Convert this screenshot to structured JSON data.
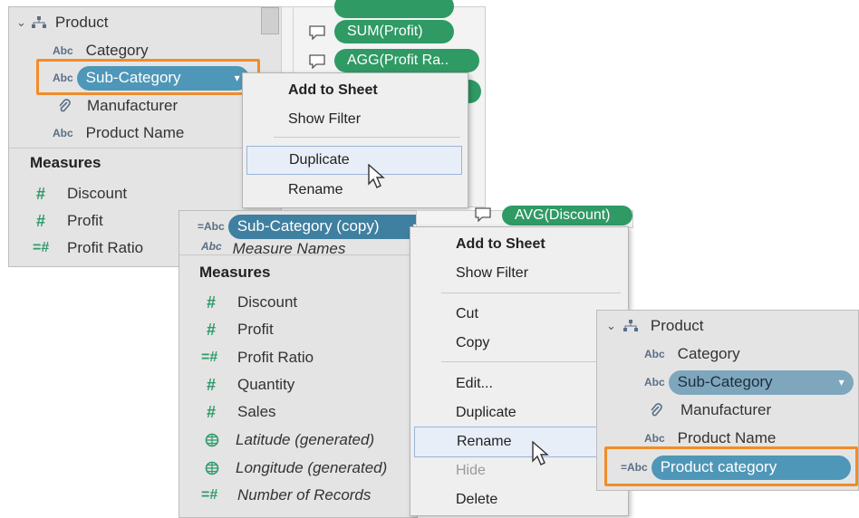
{
  "panel1": {
    "dimension_group": "Product",
    "dimensions": [
      {
        "type": "Abc",
        "label": "Category"
      },
      {
        "type": "Abc",
        "label": "Sub-Category",
        "selected": true
      },
      {
        "type": "clip",
        "label": "Manufacturer"
      },
      {
        "type": "Abc",
        "label": "Product Name"
      }
    ],
    "measures_heading": "Measures",
    "measures": [
      "Discount",
      "Profit",
      "Profit Ratio"
    ]
  },
  "marks": [
    "SUM(Profit)",
    "AGG(Profit Ra..",
    "AVG(Discount)"
  ],
  "menu1": {
    "items": [
      "Add to Sheet",
      "Show Filter",
      "Duplicate",
      "Rename"
    ],
    "highlighted": "Duplicate"
  },
  "panel2": {
    "copy_pill": "Sub-Category (copy)",
    "copy_prefix": "=Abc",
    "partial_item": "Measure Names",
    "measures_heading": "Measures",
    "measures": [
      {
        "type": "hash",
        "label": "Discount"
      },
      {
        "type": "hash",
        "label": "Profit"
      },
      {
        "type": "calc-hash",
        "label": "Profit Ratio"
      },
      {
        "type": "hash",
        "label": "Quantity"
      },
      {
        "type": "hash",
        "label": "Sales"
      },
      {
        "type": "globe",
        "label": "Latitude (generated)"
      },
      {
        "type": "globe",
        "label": "Longitude (generated)"
      },
      {
        "type": "calc-hash",
        "label": "Number of Records"
      }
    ]
  },
  "menu2": {
    "items": [
      "Add to Sheet",
      "Show Filter",
      "Cut",
      "Copy",
      "Edit...",
      "Duplicate",
      "Rename",
      "Hide",
      "Delete"
    ],
    "highlighted": "Rename",
    "disabled": "Hide"
  },
  "panel3": {
    "dimension_group": "Product",
    "dimensions": [
      {
        "type": "Abc",
        "label": "Category"
      },
      {
        "type": "Abc",
        "label": "Sub-Category"
      },
      {
        "type": "clip",
        "label": "Manufacturer"
      },
      {
        "type": "Abc",
        "label": "Product Name"
      }
    ],
    "renamed_prefix": "=Abc",
    "renamed_pill": "Product category"
  },
  "colors": {
    "pill_blue": "#4f97b8",
    "pill_green": "#2f9a64",
    "highlight_orange": "#f28c28",
    "panel_bg": "#e4e4e4"
  }
}
